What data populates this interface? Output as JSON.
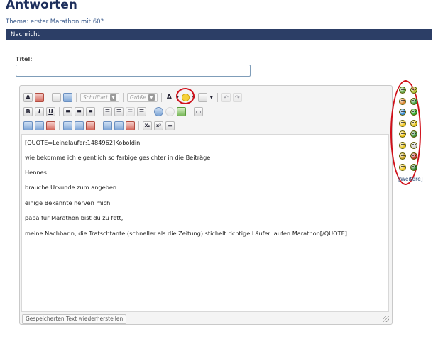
{
  "page": {
    "title": "Antworten",
    "thread": "Thema: erster Marathon mit 60?",
    "section": "Nachricht"
  },
  "form": {
    "title_label": "Titel:",
    "title_value": "",
    "restore_label": "Gespeicherten Text wiederherstellen"
  },
  "toolbar": {
    "font_label": "Schriftart",
    "size_label": "Größe",
    "font_color_glyph": "A",
    "bold": "B",
    "italic": "I",
    "underline": "U",
    "subscript": "X₂",
    "superscript": "x²"
  },
  "message_lines": [
    "[QUOTE=Leinelaufer;1484962]Koboldin",
    "wie bekomme ich eigentlich so farbige gesichter in die Beiträge",
    "Hennes",
    "brauche Urkunde zum angeben",
    "einige Bekannte nerven mich",
    "papa für Marathon bist du zu fett,",
    "meine Nachbarin, die Tratschtante (schneller als die Zeitung) stichelt richtige Läufer laufen Marathon[/QUOTE]"
  ],
  "smilies": {
    "more_label": "[Weitere]",
    "colors": [
      "#6aa84f",
      "#b7c93a",
      "#d9822b",
      "#3d9b3d",
      "#3b8ed6",
      "#2faa2f",
      "#f0c419",
      "#e5c21a",
      "#f0c419",
      "#3e8f3e",
      "#e5c21a",
      "#d0d0d0",
      "#c9a227",
      "#c0392b",
      "#f0c419",
      "#2a7a2a"
    ]
  },
  "colors": {
    "header_bar": "#2c3e66",
    "title": "#1e2f5c",
    "highlight": "#d0101a"
  }
}
